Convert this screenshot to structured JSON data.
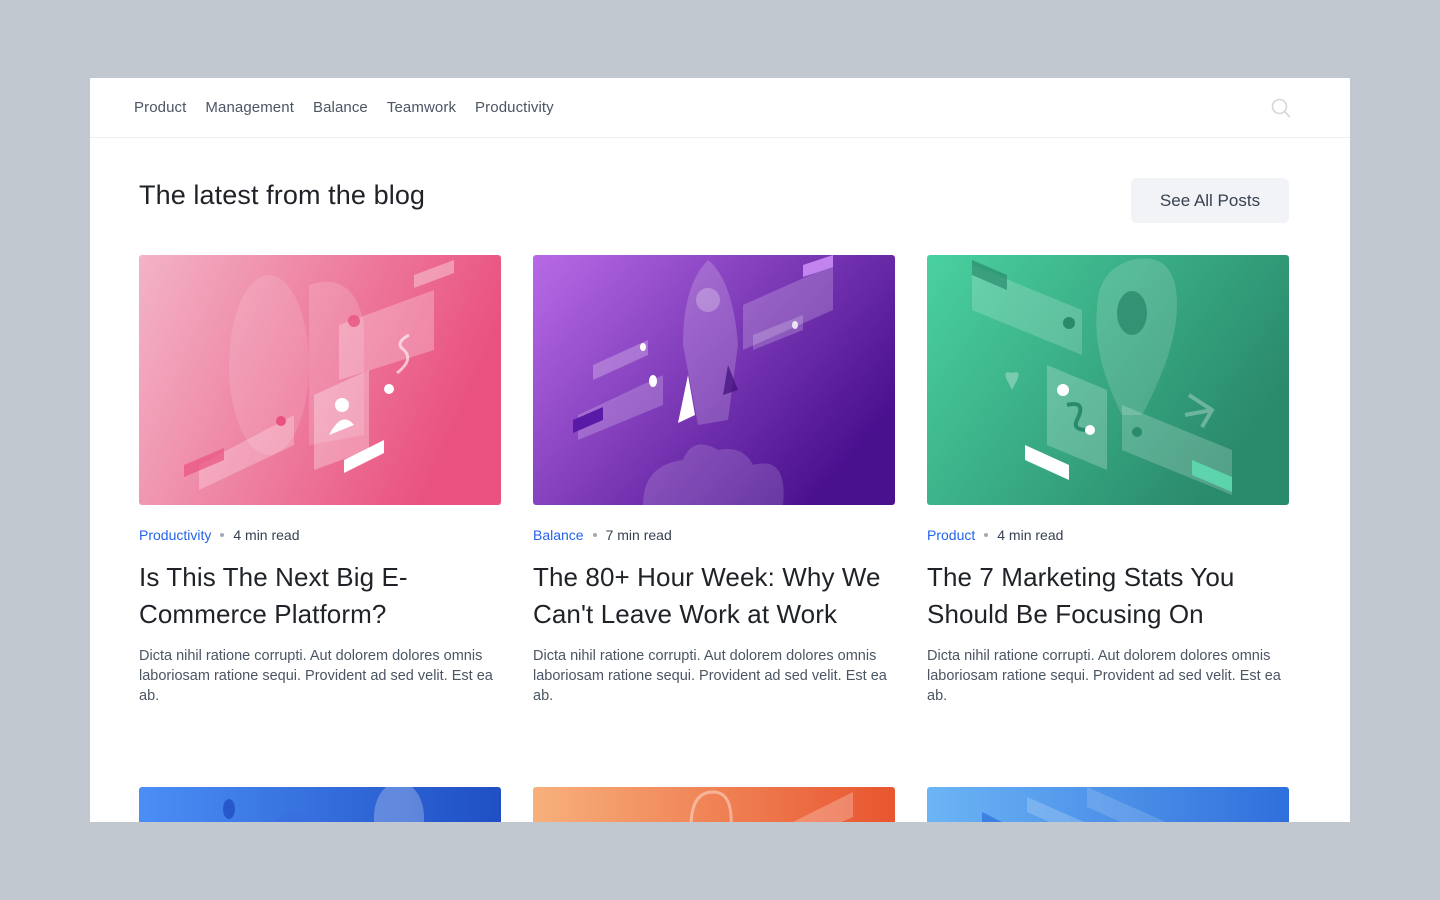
{
  "nav": {
    "links": [
      "Product",
      "Management",
      "Balance",
      "Teamwork",
      "Productivity"
    ]
  },
  "icons": {
    "search": "search-icon"
  },
  "header": {
    "title": "The latest from the blog",
    "see_all_label": "See All Posts"
  },
  "posts": [
    {
      "category": "Productivity",
      "read_time": "4 min read",
      "title": "Is This The Next Big E-Commerce Platform?",
      "excerpt": "Dicta nihil ratione corrupti. Aut dolorem dolores omnis laboriosam ratione sequi. Provident ad sed velit. Est ea ab.",
      "colors": [
        "#f3b3c6",
        "#e9517e"
      ]
    },
    {
      "category": "Balance",
      "read_time": "7 min read",
      "title": "The 80+ Hour Week: Why We Can't Leave Work at Work",
      "excerpt": "Dicta nihil ratione corrupti. Aut dolorem dolores omnis laboriosam ratione sequi. Provident ad sed velit. Est ea ab.",
      "colors": [
        "#b86ae6",
        "#4a118f"
      ]
    },
    {
      "category": "Product",
      "read_time": "4 min read",
      "title": "The 7 Marketing Stats You Should Be Focusing On",
      "excerpt": "Dicta nihil ratione corrupti. Aut dolorem dolores omnis laboriosam ratione sequi. Provident ad sed velit. Est ea ab.",
      "colors": [
        "#4ad1a0",
        "#2a8a6c"
      ]
    }
  ],
  "more_posts": [
    {
      "colors": [
        "#4b8ef5",
        "#1f4fc4"
      ]
    },
    {
      "colors": [
        "#f7b07c",
        "#e8552f"
      ]
    },
    {
      "colors": [
        "#6cb5f5",
        "#2f6fdc"
      ]
    }
  ]
}
